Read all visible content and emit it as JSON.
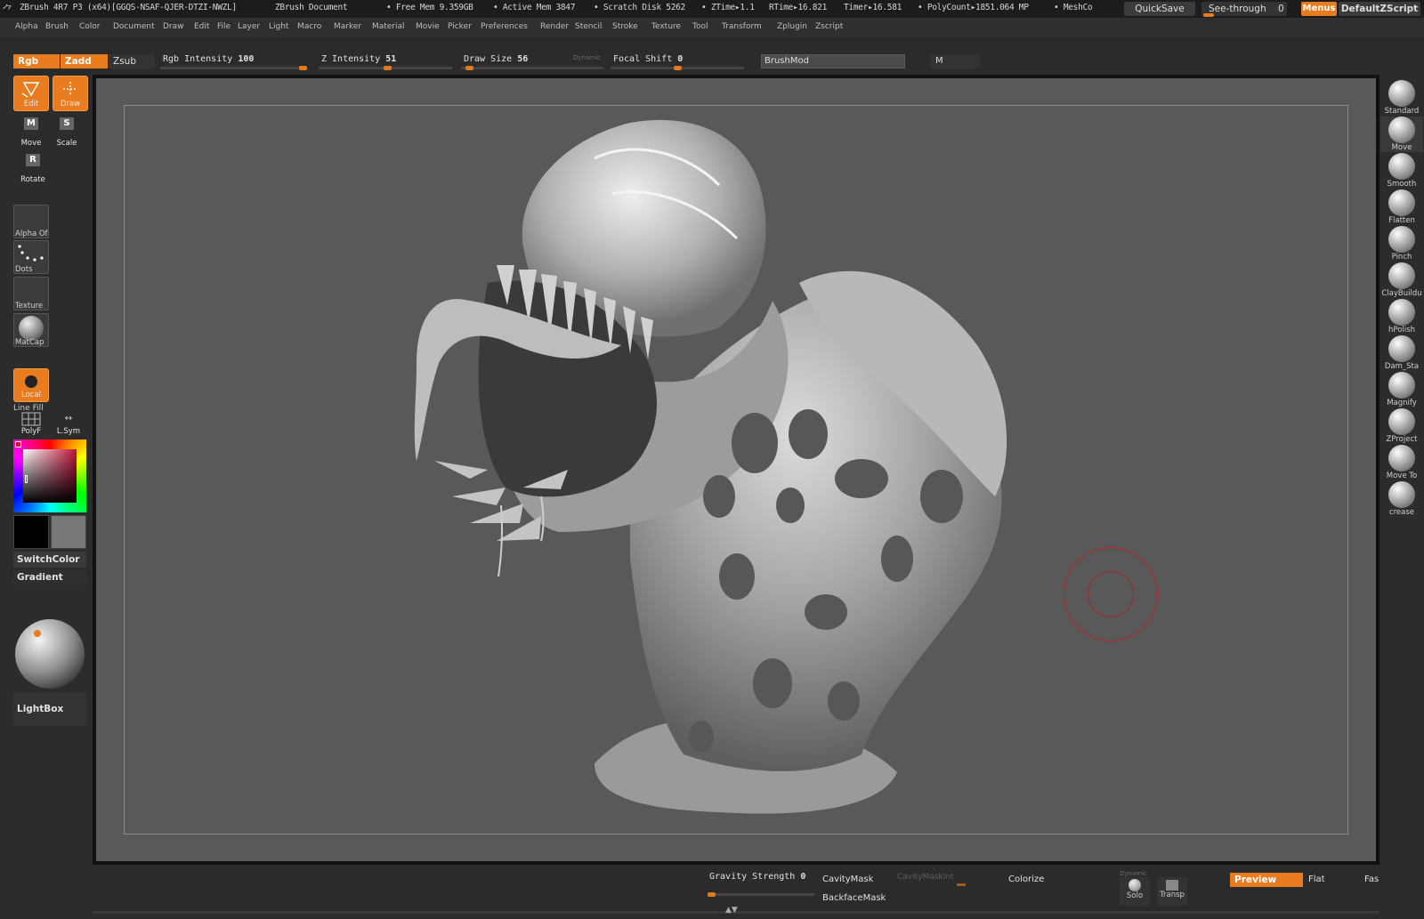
{
  "titlebar": {
    "app": "ZBrush 4R7 P3 (x64)[GGQS-NSAF-QJER-DTZI-NWZL]",
    "document": "ZBrush Document",
    "free_mem": "• Free Mem 9.359GB",
    "active_mem": "• Active Mem 3847",
    "scratch": "• Scratch Disk 5262",
    "ztime": "• ZTime▸1.1",
    "rtime": "RTime▸16.821",
    "timer": "Timer▸16.581",
    "polycount": "• PolyCount▸1851.064 MP",
    "meshcount": "• MeshCo",
    "quicksave": "QuickSave",
    "seethrough": "See-through",
    "seethrough_value": "0",
    "menus": "Menus",
    "script": "DefaultZScript"
  },
  "menu": [
    "Alpha",
    "Brush",
    "Color",
    "Document",
    "Draw",
    "Edit",
    "File",
    "Layer",
    "Light",
    "Macro",
    "Marker",
    "Material",
    "Movie",
    "Picker",
    "Preferences",
    "Render",
    "Stencil",
    "Stroke",
    "Texture",
    "Tool",
    "Transform",
    "Zplugin",
    "Zscript"
  ],
  "toolbar": {
    "rgb": "Rgb",
    "zadd": "Zadd",
    "zsub": "Zsub",
    "rgb_intensity_label": "Rgb Intensity",
    "rgb_intensity": "100",
    "z_intensity_label": "Z Intensity",
    "z_intensity": "51",
    "draw_size_label": "Draw Size",
    "draw_size": "56",
    "dynamic": "Dynamic",
    "focal_shift_label": "Focal Shift",
    "focal_shift": "0",
    "brushmod": "BrushMod",
    "m": "M"
  },
  "sliders": {
    "rgb_intensity": 1.0,
    "z_intensity": 0.51,
    "draw_size": 0.056,
    "focal_shift": 0.5
  },
  "left": {
    "edit": "Edit",
    "draw": "Draw",
    "move": "Move",
    "scale": "Scale",
    "rotate": "Rotate",
    "alpha": "Alpha Of",
    "dots": "Dots",
    "texture": "Texture",
    "matcap": "MatCap",
    "local": "Local",
    "line_fill": "Line Fill",
    "polyf": "PolyF",
    "lsym": "L.Sym",
    "switchcolor": "SwitchColor",
    "gradient": "Gradient",
    "lightbox": "LightBox"
  },
  "brushes": [
    "Standard",
    "Move",
    "Smooth",
    "Flatten",
    "Pinch",
    "ClayBuildu",
    "hPolish",
    "Dam_Sta",
    "Magnify",
    "ZProject",
    "Move To",
    "crease"
  ],
  "bottom": {
    "gravity_label": "Gravity Strength",
    "gravity": "0",
    "cavitymask": "CavityMask",
    "cavitymaskint": "CavityMaskInt",
    "backfacemask": "BackfaceMask",
    "colorize": "Colorize",
    "dynamic": "Dynamic",
    "solo": "Solo",
    "transp": "Transp",
    "preview": "Preview",
    "flat": "Flat",
    "fast": "Fas"
  },
  "colors": {
    "accent": "#e87c1e",
    "canvas": "#595959",
    "panel": "#2c2c2c"
  }
}
